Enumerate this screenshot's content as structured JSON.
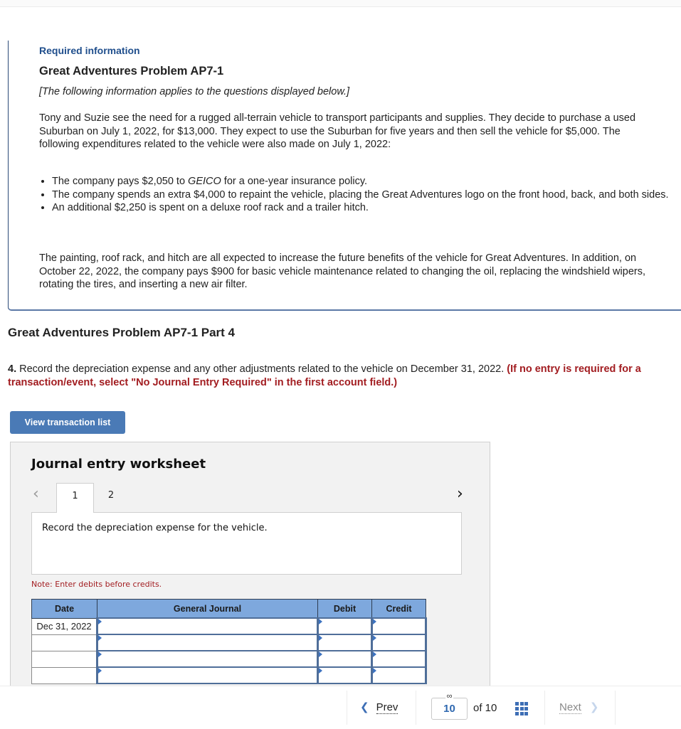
{
  "info": {
    "required_label": "Required information",
    "problem_title": "Great Adventures Problem AP7-1",
    "intro_note": "[The following information applies to the questions displayed below.]",
    "paragraph1": "Tony and Suzie see the need for a rugged all-terrain vehicle to transport participants and supplies. They decide to purchase a used Suburban on July 1, 2022, for $13,000. They expect to use the Suburban for five years and then sell the vehicle for $5,000. The following expenditures related to the vehicle were also made on July 1, 2022:",
    "bullets": [
      {
        "before": "The company pays $2,050 to ",
        "italic": "GEICO",
        "after": " for a one-year insurance policy."
      },
      {
        "text": "The company spends an extra $4,000 to repaint the vehicle, placing the Great Adventures logo on the front hood, back, and both sides."
      },
      {
        "text": "An additional $2,250 is spent on a deluxe roof rack and a trailer hitch."
      }
    ],
    "paragraph2": "The painting, roof rack, and hitch are all expected to increase the future benefits of the vehicle for Great Adventures. In addition, on October 22, 2022, the company pays $900 for basic vehicle maintenance related to changing the oil, replacing the windshield wipers, rotating the tires, and inserting a new air filter."
  },
  "part": {
    "title": "Great Adventures Problem AP7-1 Part 4",
    "question_number": "4.",
    "question_text": " Record the depreciation expense and any other adjustments related to the vehicle on December 31, 2022. ",
    "question_instruction": "(If no entry is required for a transaction/event, select \"No Journal Entry Required\" in the first account field.)",
    "view_button": "View transaction list"
  },
  "worksheet": {
    "title": "Journal entry worksheet",
    "tabs": [
      {
        "label": "1",
        "active": true
      },
      {
        "label": "2",
        "active": false
      }
    ],
    "task_text": "Record the depreciation expense for the vehicle.",
    "note": "Note: Enter debits before credits.",
    "columns": [
      "Date",
      "General Journal",
      "Debit",
      "Credit"
    ],
    "rows": [
      {
        "date": "Dec 31, 2022",
        "account": "",
        "debit": "",
        "credit": ""
      },
      {
        "date": "",
        "account": "",
        "debit": "",
        "credit": ""
      },
      {
        "date": "",
        "account": "",
        "debit": "",
        "credit": ""
      },
      {
        "date": "",
        "account": "",
        "debit": "",
        "credit": ""
      }
    ]
  },
  "pagination": {
    "prev_label": "Prev",
    "current_page": "10",
    "of_label": "of 10",
    "next_label": "Next",
    "link_icon": "link-icon",
    "grid_icon": "grid-icon"
  },
  "colors": {
    "accent_blue": "#1f4e8c",
    "button_blue": "#4a7ab6",
    "header_blue": "#7ea8dd",
    "instruction_red": "#a21d21"
  }
}
